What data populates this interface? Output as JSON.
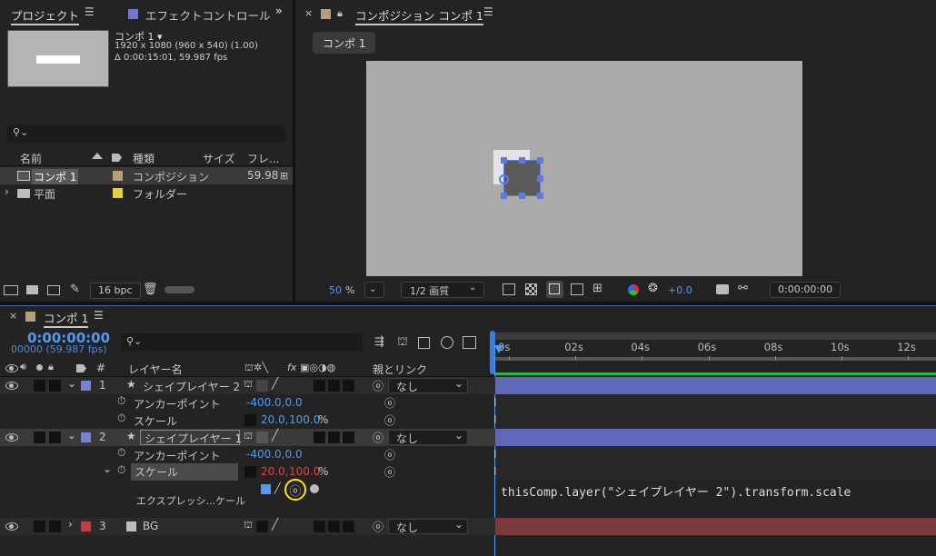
{
  "project_panel": {
    "tab_project": "プロジェクト",
    "tab_effects": "エフェクトコントロール",
    "comp_name": "コンポ 1 ▾",
    "comp_res": "1920 x 1080  (960 x 540) (1.00)",
    "comp_dur": "Δ 0:00:15:01, 59.987 fps",
    "search_placeholder": "",
    "columns": {
      "name": "名前",
      "type": "種類",
      "size": "サイズ",
      "frame": "フレ..."
    },
    "items": [
      {
        "name": "コンポ 1",
        "type": "コンポジション",
        "frame": "59.98",
        "color": "#b49e7c"
      },
      {
        "name": "平面",
        "type": "フォルダー",
        "frame": "",
        "color": "#e6d33a"
      }
    ],
    "bpc": "16 bpc"
  },
  "comp_panel": {
    "tab_title": "コンポジション コンポ 1",
    "comp_button": "コンポ 1",
    "zoom": "50",
    "zoom_unit": "%",
    "quality": "1/2 画質",
    "exposure": "+0.0",
    "timecode": "0:00:00:00"
  },
  "timeline": {
    "tab_title": "コンポ 1",
    "timecode": "0:00:00:00",
    "frames": "00000 (59.987 fps)",
    "search_placeholder": "",
    "col_hash": "#",
    "col_layer_name": "レイヤー名",
    "col_parent": "親とリンク",
    "switch_labels": "fx",
    "ruler": [
      "0s",
      "02s",
      "04s",
      "06s",
      "08s",
      "10s",
      "12s"
    ],
    "layers": [
      {
        "num": "1",
        "name": "シェイプレイヤー 2",
        "parent": "なし",
        "color": "#7582d6",
        "anchor_label": "アンカーポイント",
        "anchor_value": "-400.0,0.0",
        "scale_label": "スケール",
        "scale_value_a": "20.0,",
        "scale_value_b": "100.0",
        "scale_unit": "%"
      },
      {
        "num": "2",
        "name": "シェイプレイヤー 1",
        "parent": "なし",
        "color": "#7582d6",
        "anchor_label": "アンカーポイント",
        "anchor_value": "-400.0,0.0",
        "scale_label": "スケール",
        "scale_value_a": "20.0,",
        "scale_value_b": "100.0",
        "scale_unit": "%",
        "expr_label": "エクスプレッシ...ケール",
        "expr_code": "thisComp.layer(\"シェイプレイヤー 2\").transform.scale"
      },
      {
        "num": "3",
        "name": "BG",
        "parent": "なし",
        "color": "#c43c3c"
      }
    ]
  },
  "colors": {
    "accent_blue": "#4d9bf5",
    "timecode_blue": "#4d9bf5",
    "bar_blue": "#5f67b8",
    "bar_red": "#7a3a3e",
    "bar_green": "#2bb24a",
    "highlight_yellow": "#ffe600"
  }
}
